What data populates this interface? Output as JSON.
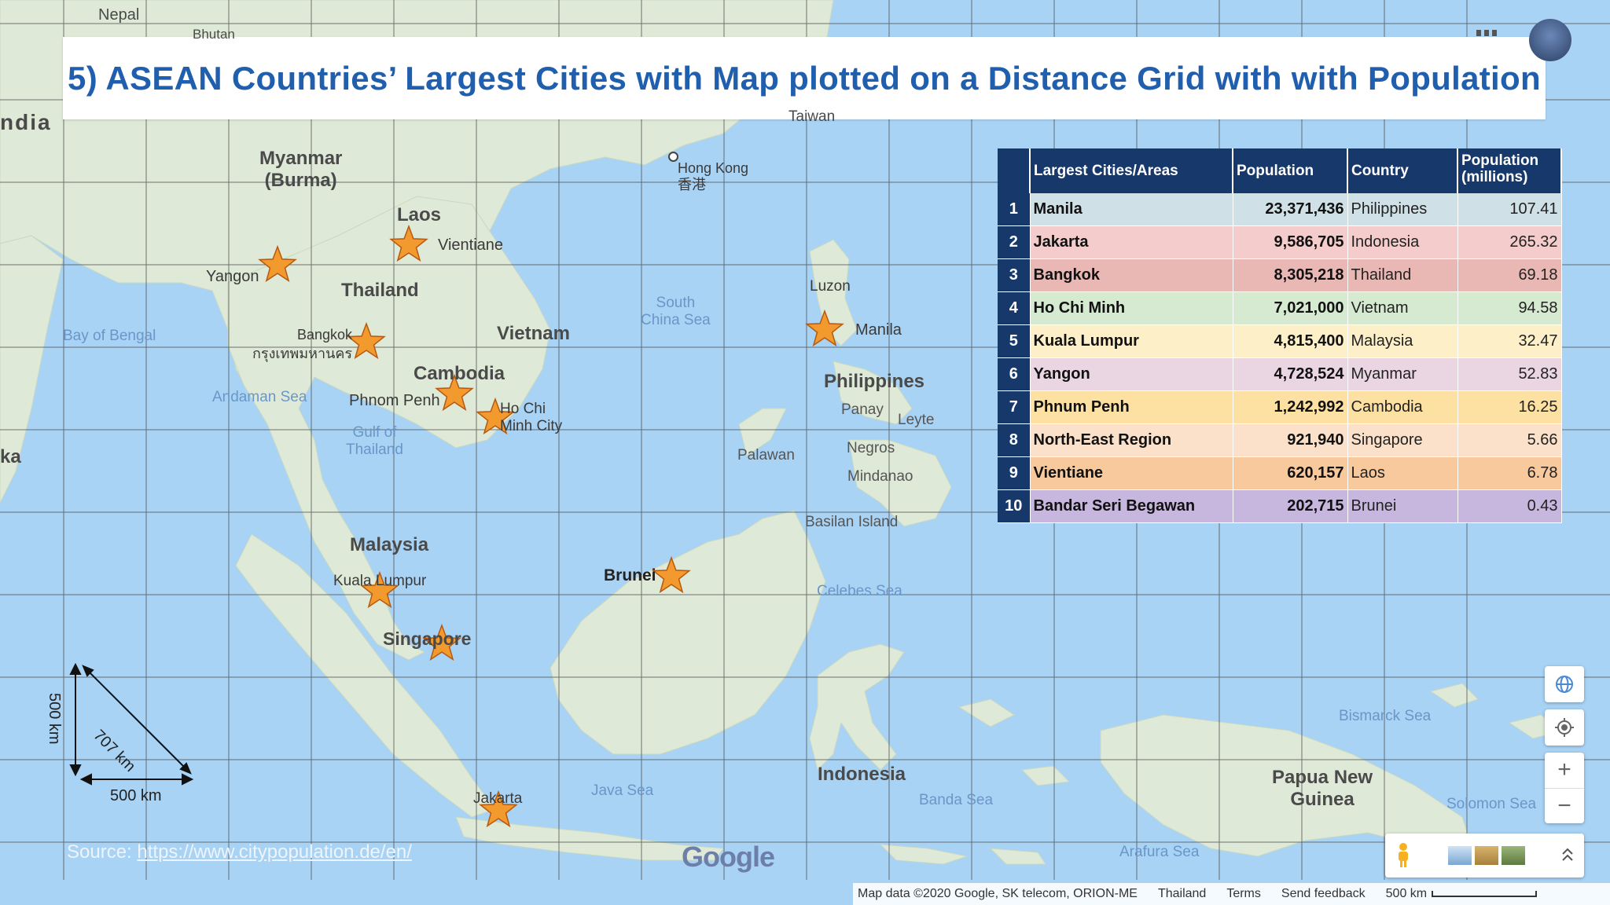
{
  "title": "5) ASEAN Countries’ Largest Cities with Map plotted on a Distance Grid with with Population",
  "table": {
    "headers": [
      "Largest Cities/Areas",
      "Population",
      "Country",
      "Population (millions)"
    ],
    "rows": [
      {
        "rank": "1",
        "city": "Manila",
        "population": "23,371,436",
        "country": "Philippines",
        "millions": "107.41",
        "color": "#cfe0e6"
      },
      {
        "rank": "2",
        "city": "Jakarta",
        "population": "9,586,705",
        "country": "Indonesia",
        "millions": "265.32",
        "color": "#f3cccb"
      },
      {
        "rank": "3",
        "city": "Bangkok",
        "population": "8,305,218",
        "country": "Thailand",
        "millions": "69.18",
        "color": "#e9b8b4"
      },
      {
        "rank": "4",
        "city": "Ho Chi Minh",
        "population": "7,021,000",
        "country": "Vietnam",
        "millions": "94.58",
        "color": "#d6e9d1"
      },
      {
        "rank": "5",
        "city": "Kuala Lumpur",
        "population": "4,815,400",
        "country": "Malaysia",
        "millions": "32.47",
        "color": "#fdf0c9"
      },
      {
        "rank": "6",
        "city": "Yangon",
        "population": "4,728,524",
        "country": "Myanmar",
        "millions": "52.83",
        "color": "#ead5e2"
      },
      {
        "rank": "7",
        "city": "Phnum Penh",
        "population": "1,242,992",
        "country": "Cambodia",
        "millions": "16.25",
        "color": "#fde1a3"
      },
      {
        "rank": "8",
        "city": "North-East Region",
        "population": "921,940",
        "country": "Singapore",
        "millions": "5.66",
        "color": "#fbe1c9"
      },
      {
        "rank": "9",
        "city": "Vientiane",
        "population": "620,157",
        "country": "Laos",
        "millions": "6.78",
        "color": "#f8c99c"
      },
      {
        "rank": "10",
        "city": "Bandar Seri Begawan",
        "population": "202,715",
        "country": "Brunei",
        "millions": "0.43",
        "color": "#c7b6de"
      }
    ]
  },
  "map_labels": {
    "nepal": "Nepal",
    "bhutan": "Bhutan",
    "india": "ndia",
    "lanka": "ka",
    "taiwan": "Taiwan",
    "myanmar": "Myanmar\n(Burma)",
    "laos": "Laos",
    "vientiane": "Vientiane",
    "yangon": "Yangon",
    "thailand": "Thailand",
    "bay_of_bengal": "Bay of Bengal",
    "bangkok": "Bangkok",
    "bangkok_thai": "กรุงเทพมหานคร",
    "vietnam": "Vietnam",
    "cambodia": "Cambodia",
    "phnom_penh": "Phnom Penh",
    "hcmc": "Ho Chi\nMinh City",
    "andaman": "Andaman Sea",
    "gulf": "Gulf of\nThailand",
    "hong_kong": "Hong Kong\n香港",
    "south_china_sea": "South\nChina Sea",
    "luzon": "Luzon",
    "manila": "Manila",
    "philippines": "Philippines",
    "panay": "Panay",
    "leyte": "Leyte",
    "palawan": "Palawan",
    "negros": "Negros",
    "mindanao": "Mindanao",
    "basilan": "Basilan Island",
    "malaysia": "Malaysia",
    "kuala_lumpur": "Kuala Lumpur",
    "brunei": "Brunei",
    "celebes": "Celebes Sea",
    "singapore": "Singapore",
    "java_sea": "Java Sea",
    "jakarta": "Jakarta",
    "indonesia": "Indonesia",
    "banda": "Banda Sea",
    "bismarck": "Bismarck Sea",
    "png": "Papua New\nGuinea",
    "solomon": "Solomon Sea",
    "arafura": "Arafura Sea",
    "google": "Google"
  },
  "scale": {
    "vertical": "500 km",
    "diagonal": "707 km",
    "horizontal": "500 km"
  },
  "source": {
    "prefix": "Source: ",
    "url": "https://www.citypopulation.de/en/"
  },
  "footer": {
    "map_data": "Map data ©2020 Google, SK telecom, ORION-ME",
    "region": "Thailand",
    "terms": "Terms",
    "feedback": "Send feedback",
    "scale": "500 km"
  },
  "controls": {
    "globe_icon": "globe-icon",
    "location_icon": "my-location-icon",
    "zoom_in": "+",
    "zoom_out": "−",
    "pegman_icon": "pegman-icon",
    "expand_icon": "chevron-up-icon"
  },
  "colors": {
    "title": "#1f5fae",
    "table_header": "#16386b",
    "sea": "#a9d3f5",
    "land": "#dfe9d7",
    "star": "#f39a2e",
    "grid": "#4a4a4a"
  }
}
